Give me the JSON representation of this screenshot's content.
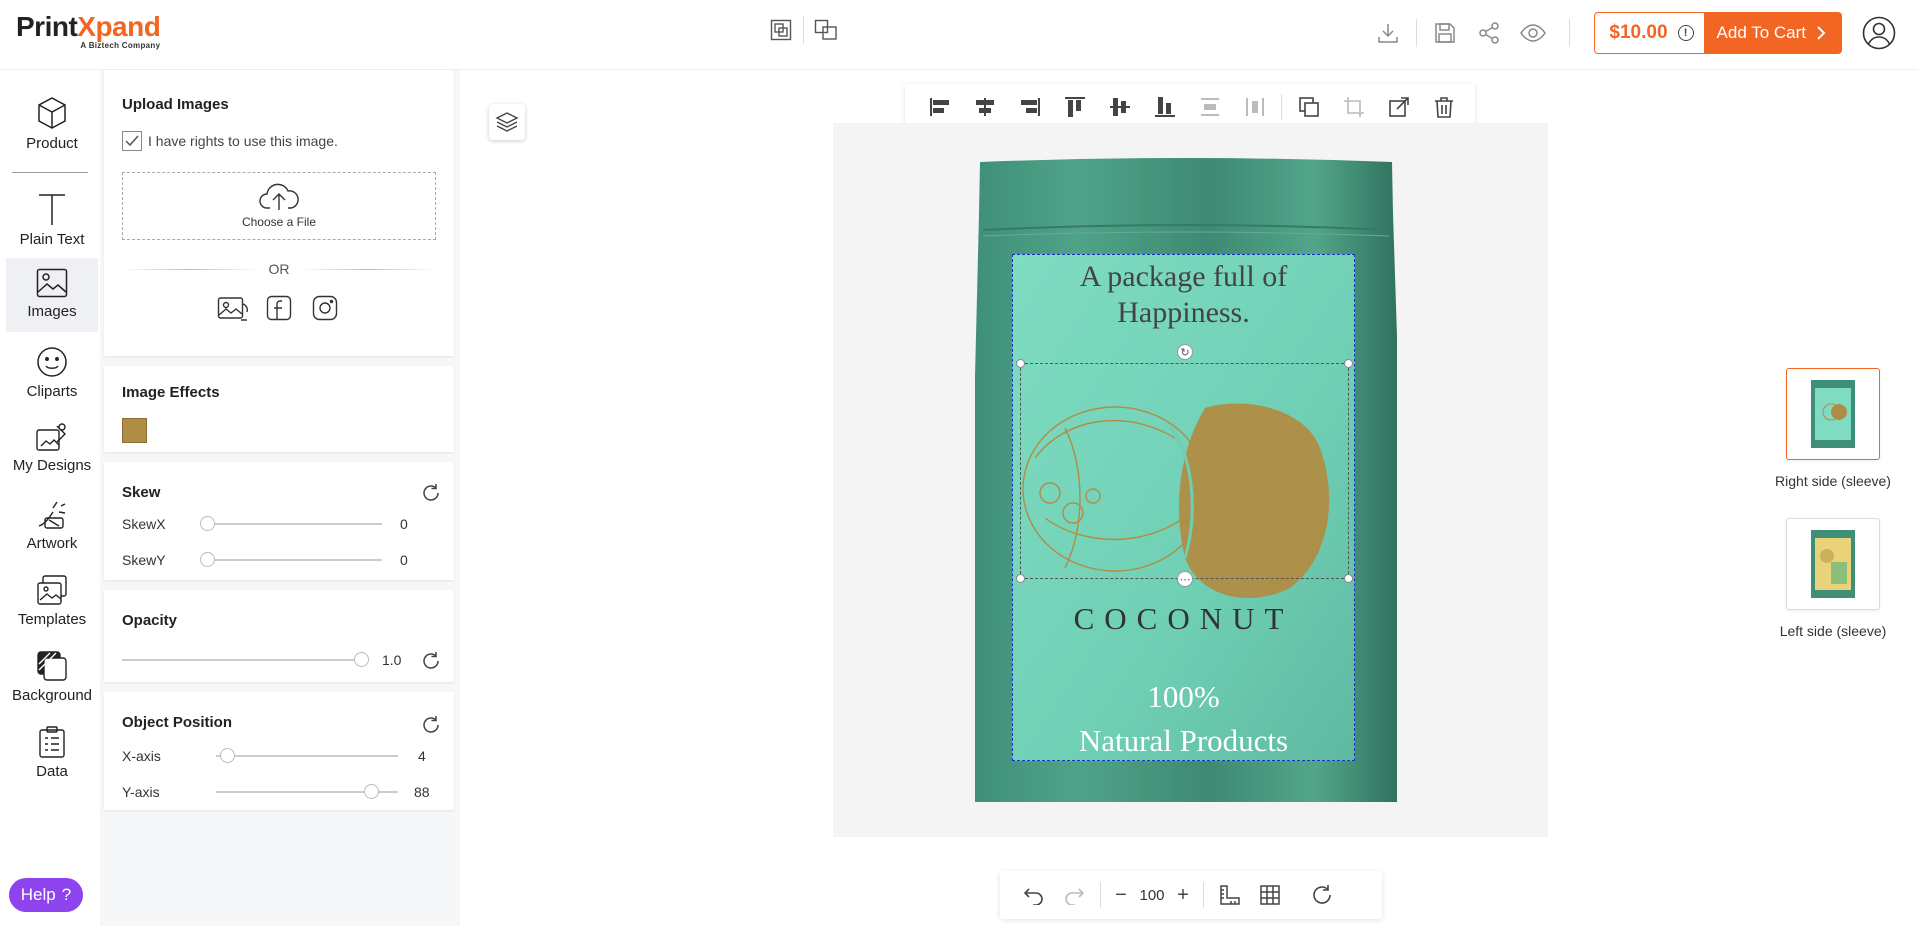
{
  "brand": {
    "name_part1": "Print",
    "name_part2": "Xpand",
    "tagline": "A Biztech Company",
    "accent": "#f26522"
  },
  "header": {
    "price": "$10.00",
    "price_info": "!",
    "add_to_cart": "Add To Cart",
    "icons": [
      "group-icon",
      "ungroup-icon",
      "download-icon",
      "save-icon",
      "share-icon",
      "preview-icon",
      "user-icon"
    ]
  },
  "rail": {
    "items": [
      {
        "label": "Product",
        "icon": "cube-icon"
      },
      {
        "label": "Plain Text",
        "icon": "text-icon"
      },
      {
        "label": "Images",
        "icon": "image-icon",
        "active": true
      },
      {
        "label": "Cliparts",
        "icon": "smiley-icon"
      },
      {
        "label": "My Designs",
        "icon": "designs-icon"
      },
      {
        "label": "Artwork",
        "icon": "artwork-icon"
      },
      {
        "label": "Templates",
        "icon": "templates-icon"
      },
      {
        "label": "Background",
        "icon": "background-icon"
      },
      {
        "label": "Data",
        "icon": "data-icon"
      }
    ],
    "help": "Help",
    "help_icon": "?"
  },
  "upload": {
    "title": "Upload Images",
    "rights_label": "I have rights to use this image.",
    "rights_checked": true,
    "choose_file": "Choose a File",
    "or": "OR"
  },
  "effects": {
    "title": "Image Effects",
    "swatch_color": "#b08d45"
  },
  "skew": {
    "title": "Skew",
    "skew_x_label": "SkewX",
    "skew_x": "0",
    "skew_y_label": "SkewY",
    "skew_y": "0"
  },
  "opacity": {
    "title": "Opacity",
    "value": "1.0"
  },
  "position": {
    "title": "Object Position",
    "x_label": "X-axis",
    "x_value": "4",
    "y_label": "Y-axis",
    "y_value": "88"
  },
  "design": {
    "line1": "A package full of",
    "line2": "Happiness.",
    "product_name": "COCONUT",
    "claim1": "100%",
    "claim2": "Natural Products"
  },
  "zoom": {
    "value": "100",
    "minus": "−",
    "plus": "+"
  },
  "sides": [
    {
      "label": "Right side (sleeve)",
      "active": true
    },
    {
      "label": "Left side (sleeve)",
      "active": false
    }
  ]
}
